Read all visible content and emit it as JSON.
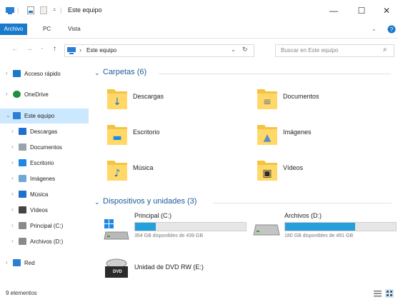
{
  "window": {
    "title": "Este equipo",
    "minimize": "—",
    "maximize": "☐",
    "close": "✕"
  },
  "ribbon": {
    "tabs": [
      "Archivo",
      "PC",
      "Vista"
    ]
  },
  "nav": {
    "back": "←",
    "forward": "→",
    "up": "↑",
    "address_separator": "›",
    "address": "Este equipo",
    "dropdown": "⌄",
    "refresh": "↻",
    "search_placeholder": "Buscar en Este equipo",
    "search_icon": "⌕"
  },
  "sidebar": {
    "items": [
      {
        "label": "Acceso rápido",
        "icon": "star-icon",
        "color": "#1979ca",
        "level": 0,
        "selected": false
      },
      {
        "label": "OneDrive",
        "icon": "cloud-icon",
        "color": "#1f8f3d",
        "level": 0,
        "selected": false
      },
      {
        "label": "Este equipo",
        "icon": "computer-icon",
        "color": "#2a7fd4",
        "level": 0,
        "selected": true
      },
      {
        "label": "Descargas",
        "icon": "download-icon",
        "color": "#1e6fd0",
        "level": 1,
        "selected": false
      },
      {
        "label": "Documentos",
        "icon": "document-icon",
        "color": "#9aa4ad",
        "level": 1,
        "selected": false
      },
      {
        "label": "Escritorio",
        "icon": "desktop-icon",
        "color": "#1e88e5",
        "level": 1,
        "selected": false
      },
      {
        "label": "Imágenes",
        "icon": "pictures-icon",
        "color": "#6fa7d9",
        "level": 1,
        "selected": false
      },
      {
        "label": "Música",
        "icon": "music-icon",
        "color": "#1e6fd0",
        "level": 1,
        "selected": false
      },
      {
        "label": "Vídeos",
        "icon": "video-icon",
        "color": "#444444",
        "level": 1,
        "selected": false
      },
      {
        "label": "Principal (C:)",
        "icon": "drive-icon",
        "color": "#8a8a8a",
        "level": 1,
        "selected": false
      },
      {
        "label": "Archivos (D:)",
        "icon": "drive-icon",
        "color": "#8a8a8a",
        "level": 1,
        "selected": false
      },
      {
        "label": "Red",
        "icon": "network-icon",
        "color": "#2a7fd4",
        "level": 0,
        "selected": false
      }
    ]
  },
  "folders_section": {
    "title": "Carpetas (6)",
    "items": [
      {
        "name": "Descargas",
        "icon": "download-folder-icon"
      },
      {
        "name": "Documentos",
        "icon": "documents-folder-icon"
      },
      {
        "name": "Escritorio",
        "icon": "desktop-folder-icon"
      },
      {
        "name": "Imágenes",
        "icon": "pictures-folder-icon"
      },
      {
        "name": "Música",
        "icon": "music-folder-icon"
      },
      {
        "name": "Vídeos",
        "icon": "videos-folder-icon"
      }
    ]
  },
  "drives_section": {
    "title": "Dispositivos y unidades (3)",
    "drives": [
      {
        "name": "Principal (C:)",
        "free": "354 GB disponibles de 439 GB",
        "used_fraction": 0.19
      },
      {
        "name": "Archivos (D:)",
        "free": "180 GB disponibles de 491 GB",
        "used_fraction": 0.63
      }
    ],
    "dvd": {
      "name": "Unidad de DVD RW (E:)",
      "badge": "DVD"
    }
  },
  "status": {
    "text": "9 elementos"
  },
  "colors": {
    "accent": "#1979ca",
    "section_title": "#1e5a99",
    "selection": "#cce8ff",
    "folder_yellow": "#f5c342",
    "drive_fill": "#26a0da"
  }
}
